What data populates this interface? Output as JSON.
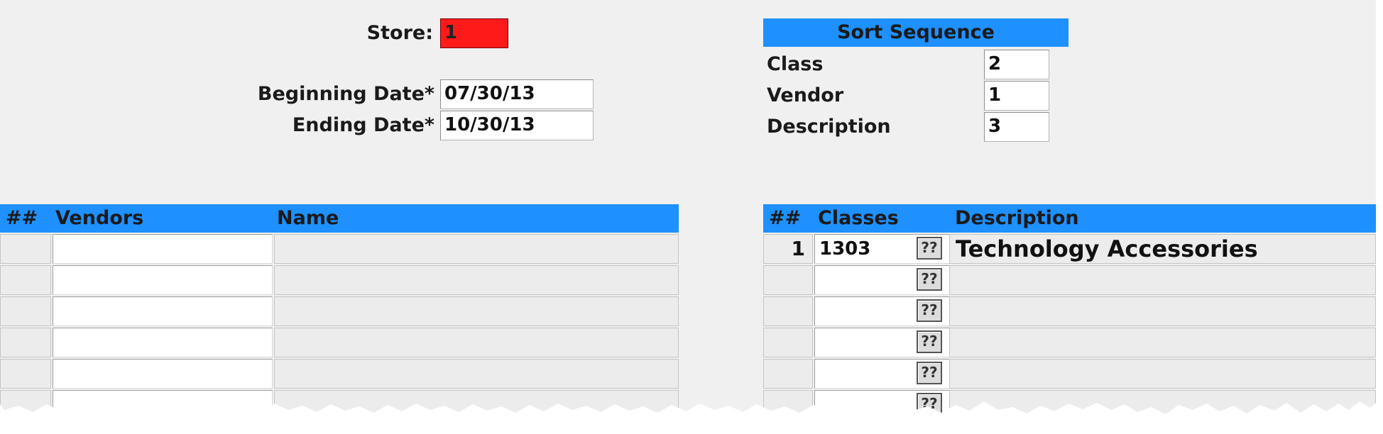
{
  "filters": {
    "store_label": "Store:",
    "store_value": "1",
    "beginning_date_label": "Beginning Date*",
    "beginning_date_value": "07/30/13",
    "ending_date_label": "Ending Date*",
    "ending_date_value": "10/30/13"
  },
  "sort_sequence": {
    "title": "Sort Sequence",
    "items": [
      {
        "label": "Class",
        "value": "2"
      },
      {
        "label": "Vendor",
        "value": "1"
      },
      {
        "label": "Description",
        "value": "3"
      }
    ]
  },
  "vendors_table": {
    "columns": [
      "##",
      "Vendors",
      "Name"
    ],
    "rows": [
      {
        "num": "",
        "vendor": "",
        "name": ""
      },
      {
        "num": "",
        "vendor": "",
        "name": ""
      },
      {
        "num": "",
        "vendor": "",
        "name": ""
      },
      {
        "num": "",
        "vendor": "",
        "name": ""
      },
      {
        "num": "",
        "vendor": "",
        "name": ""
      },
      {
        "num": "",
        "vendor": "",
        "name": ""
      }
    ]
  },
  "classes_table": {
    "columns": [
      "##",
      "Classes",
      "Description"
    ],
    "lookup_label": "??",
    "rows": [
      {
        "num": "1",
        "class": "1303",
        "description": "Technology Accessories"
      },
      {
        "num": "",
        "class": "",
        "description": ""
      },
      {
        "num": "",
        "class": "",
        "description": ""
      },
      {
        "num": "",
        "class": "",
        "description": ""
      },
      {
        "num": "",
        "class": "",
        "description": ""
      },
      {
        "num": "",
        "class": "",
        "description": ""
      }
    ]
  },
  "colors": {
    "header_blue": "#1e90ff",
    "store_field_red": "#ff1a1a",
    "background": "#f0f0f0"
  }
}
